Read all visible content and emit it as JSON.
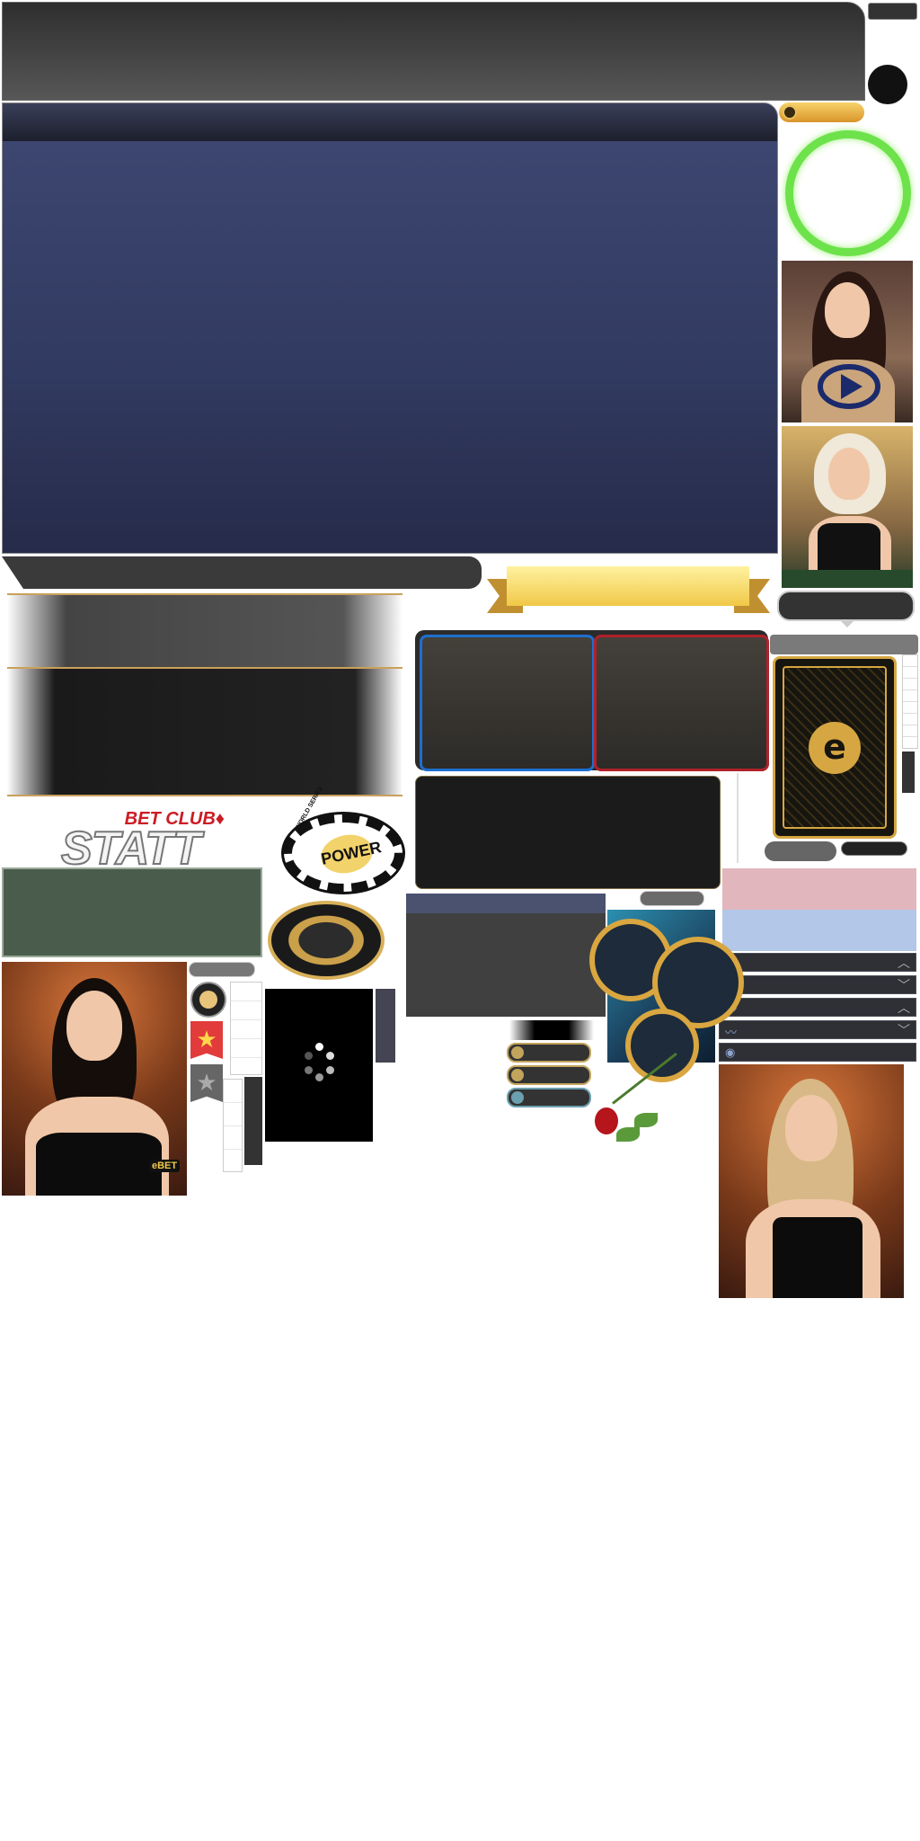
{
  "logo": {
    "top_text": "BET CLUB",
    "main_text": "STATT",
    "suit": "♦"
  },
  "chip": {
    "label": "POWER",
    "ring_text": "WORLD SERIES"
  },
  "card_back": {
    "emblem": "e"
  },
  "dealer_badge": {
    "text": "eBET"
  },
  "status_rows": [
    {
      "icon": "info-icon",
      "glyph": "ⓘ",
      "chevron": "︿"
    },
    {
      "icon": "info-icon",
      "glyph": "ⓘ",
      "chevron": "﹀"
    },
    {
      "icon": "trend-icon",
      "glyph": "〰",
      "chevron": "︿"
    },
    {
      "icon": "trend-icon",
      "glyph": "〰",
      "chevron": "﹀"
    },
    {
      "icon": "globe-icon",
      "glyph": "◉",
      "chevron": ""
    }
  ],
  "colors": {
    "accent_gold": "#d5a642",
    "ring_green": "#6de24a",
    "panel_blue": "#3d4670",
    "banker_red": "#b0222a",
    "player_blue": "#1f6fd0"
  }
}
